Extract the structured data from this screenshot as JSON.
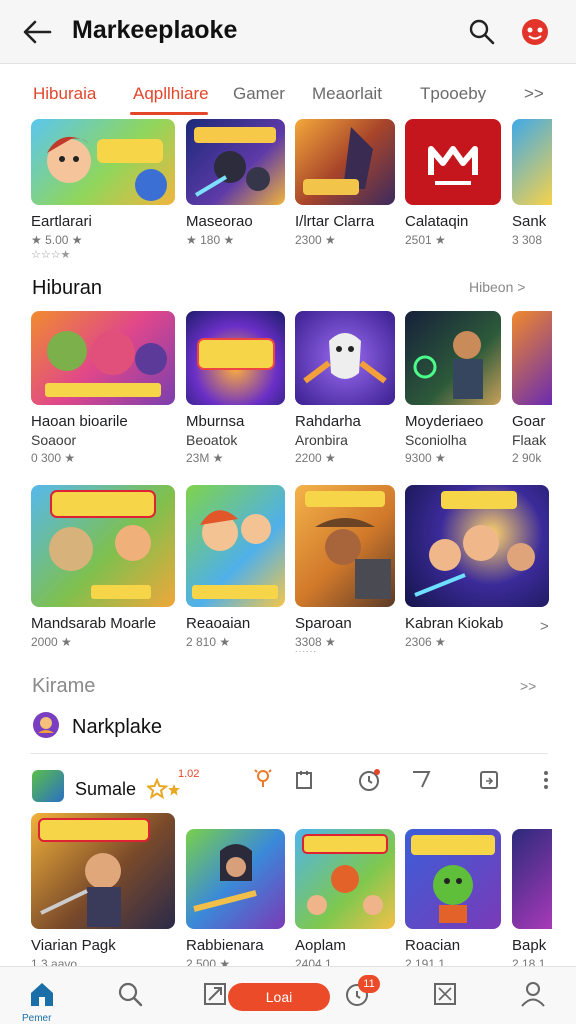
{
  "header": {
    "title": "Markeeplaoke"
  },
  "tabs": [
    {
      "label": "Hiburaia",
      "active": false
    },
    {
      "label": "Aqpllhiare",
      "active": true
    },
    {
      "label": "Gamer",
      "active": false
    },
    {
      "label": "Meaorlait",
      "active": false
    },
    {
      "label": "Tpooeby",
      "active": false
    },
    {
      "label": ">>",
      "active": false
    }
  ],
  "row1": [
    {
      "name": "Eartlarari",
      "meta": "★ 5.00 ★",
      "meta2": "☆☆☆★",
      "icon": "cartoon-boy-game-thumb"
    },
    {
      "name": "Maseorao",
      "meta": "★ 180 ★",
      "icon": "action-hero-game-thumb"
    },
    {
      "name": "I/lrtar Clarra",
      "meta": "2300 ★",
      "icon": "warrior-game-thumb"
    },
    {
      "name": "Calataqin",
      "meta": "2501 ★",
      "icon": "red-logo-app-thumb"
    },
    {
      "name": "Sank",
      "meta": "3 308",
      "icon": "yellow-character-thumb"
    }
  ],
  "section1": {
    "title": "Hiburan",
    "more": "Hibeon >"
  },
  "row2": [
    {
      "name": "Haoan bioarile",
      "sub": "Soaoor",
      "meta": "0 300 ★",
      "icon": "monster-party-game-thumb"
    },
    {
      "name": "Mburnsa",
      "sub": "Beoatok",
      "meta": "23M ★",
      "icon": "neon-logo-game-thumb"
    },
    {
      "name": "Rahdarha",
      "sub": "Aronbira",
      "meta": "2200 ★",
      "icon": "robot-glove-game-thumb"
    },
    {
      "name": "Moyderiaeo",
      "sub": "Sconiolha",
      "meta": "9300 ★",
      "icon": "sci-fi-shooter-thumb"
    },
    {
      "name": "Goar",
      "sub": "Flaak",
      "meta": "2 90k",
      "icon": "fantasy-knight-thumb"
    }
  ],
  "row3": [
    {
      "name": "Mandsarab Moarle",
      "meta": "2000 ★",
      "icon": "teddy-adventure-thumb"
    },
    {
      "name": "Reaoaian",
      "meta": "2 810 ★",
      "icon": "cartoon-duo-game-thumb"
    },
    {
      "name": "Sparoan",
      "meta": "3308 ★",
      "meta2": "˙˙˙˙˙˙",
      "icon": "cowboy-game-thumb"
    },
    {
      "name": "Kabran Kiokab",
      "meta": "2306 ★",
      "icon": "heroes-squad-thumb"
    },
    {
      "name": ">",
      "meta": "",
      "icon": ""
    }
  ],
  "section2": {
    "title": "Kirame",
    "more": ">>"
  },
  "featured": {
    "title": "Narkplake"
  },
  "toolbar": {
    "title": "Sumale",
    "badge": "1.02"
  },
  "row4": [
    {
      "name": "Viarian Pagk",
      "meta": "1.3 aavo",
      "icon": "adventure-map-thumb"
    },
    {
      "name": "Rabbienara",
      "meta": "2 500 ★",
      "icon": "hooded-hero-thumb"
    },
    {
      "name": "Aoplam",
      "meta": "2404 1",
      "icon": "kingdom-game-thumb"
    },
    {
      "name": "Roacian",
      "meta": "2 191 1",
      "icon": "green-monster-thumb"
    },
    {
      "name": "Bapk",
      "meta": "2 18 1",
      "icon": "purple-hero-thumb"
    }
  ],
  "bottomNav": {
    "homeLabel": "Pemer",
    "loadLabel": "Loai",
    "notifCount": "11"
  },
  "colors": {
    "accent": "#e4462a",
    "blue": "#1b6fa8"
  }
}
